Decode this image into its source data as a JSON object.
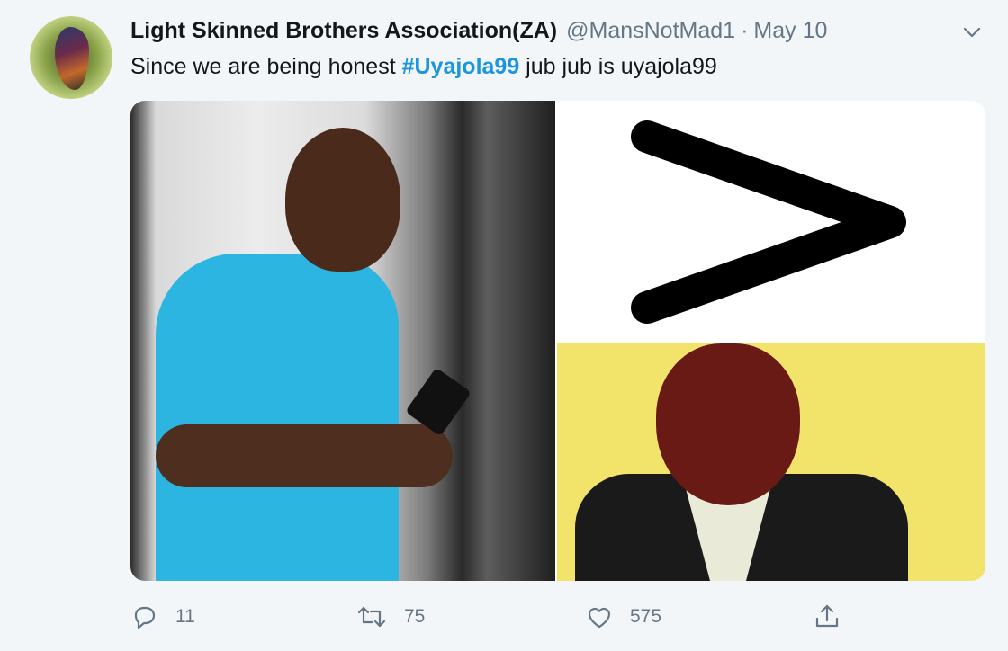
{
  "tweet": {
    "display_name": "Light Skinned Brothers Association(ZA)",
    "handle": "@MansNotMad1",
    "separator": "·",
    "date": "May 10",
    "text_before": "Since we are being honest ",
    "hashtag": "#Uyajola99",
    "text_after": " jub jub is uyajola99"
  },
  "media": {
    "greater_than_symbol": ">"
  },
  "actions": {
    "reply_count": "11",
    "retweet_count": "75",
    "like_count": "575"
  },
  "colors": {
    "accent": "#1b95e0",
    "muted": "#657786",
    "background": "#f3f6f8"
  },
  "icons": [
    "reply-icon",
    "retweet-icon",
    "like-icon",
    "share-icon",
    "chevron-down-icon"
  ]
}
